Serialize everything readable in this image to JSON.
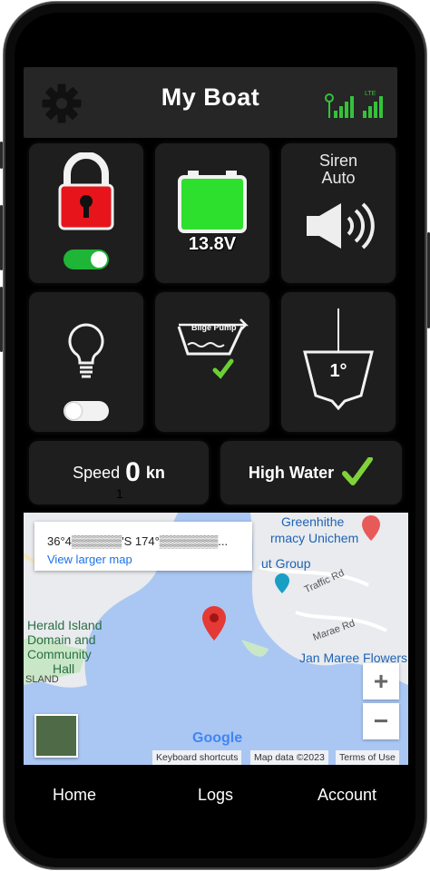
{
  "header": {
    "title": "My Boat",
    "signal_tag": "LTE",
    "accent_color": "#35c23a"
  },
  "tiles": {
    "lock": {
      "toggle_on": true
    },
    "battery": {
      "voltage": "13.8V"
    },
    "siren": {
      "line1": "Siren",
      "line2": "Auto"
    },
    "light": {
      "toggle_on": false
    },
    "bilge": {
      "label": "Bilge Pump"
    },
    "tilt": {
      "angle": "1°"
    }
  },
  "status": {
    "speed_label": "Speed",
    "speed_value": "0",
    "speed_unit": "kn",
    "speed_sub": "1",
    "high_water_label": "High Water"
  },
  "map": {
    "coords": "36°4▒▒▒▒▒▒'S 174°▒▒▒▒▒▒▒...",
    "view_larger": "View larger map",
    "labels": {
      "greenhithe": "Greenhithe",
      "pharmacy": "rmacy Unichem",
      "group": "ut Group",
      "traffic_rd": "Traffic Rd",
      "marae_rd": "Marae Rd",
      "herald1": "Herald Island",
      "herald2": "Domain and",
      "herald3": "Community",
      "herald4": "Hall",
      "island": "SLAND",
      "jan_maree": "Jan Maree Flowers"
    },
    "zoom_in": "+",
    "zoom_out": "−",
    "google": "Google",
    "shortcuts": "Keyboard shortcuts",
    "map_data": "Map data ©2023",
    "terms": "Terms of Use"
  },
  "nav": {
    "home": "Home",
    "logs": "Logs",
    "account": "Account"
  }
}
